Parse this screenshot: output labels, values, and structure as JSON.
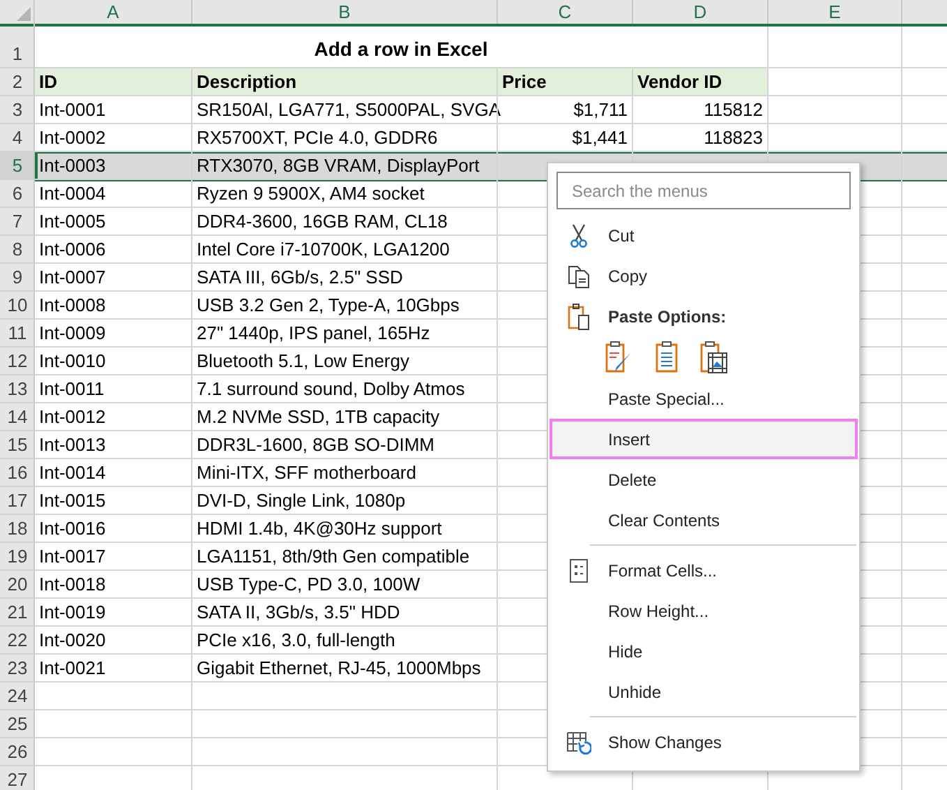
{
  "columns": [
    "A",
    "B",
    "C",
    "D",
    "E"
  ],
  "rows": [
    {
      "header": "1",
      "kind": "title",
      "selected": false,
      "title": "Add a row in Excel"
    },
    {
      "header": "2",
      "kind": "heading",
      "selected": false,
      "cells": [
        "ID",
        "Description",
        "Price",
        "Vendor ID"
      ]
    },
    {
      "header": "3",
      "kind": "data",
      "selected": false,
      "cells": [
        "Int-0001",
        "SR150Al, LGA771, S5000PAL, SVGA",
        "$1,711",
        "115812"
      ]
    },
    {
      "header": "4",
      "kind": "data",
      "selected": false,
      "cells": [
        "Int-0002",
        "RX5700XT, PCIe 4.0, GDDR6",
        "$1,441",
        "118823"
      ]
    },
    {
      "header": "5",
      "kind": "data",
      "selected": true,
      "cells": [
        "Int-0003",
        "RTX3070, 8GB VRAM, DisplayPort"
      ]
    },
    {
      "header": "6",
      "kind": "data",
      "selected": false,
      "cells": [
        "Int-0004",
        "Ryzen 9 5900X, AM4 socket"
      ]
    },
    {
      "header": "7",
      "kind": "data",
      "selected": false,
      "cells": [
        "Int-0005",
        "DDR4-3600, 16GB RAM, CL18"
      ]
    },
    {
      "header": "8",
      "kind": "data",
      "selected": false,
      "cells": [
        "Int-0006",
        "Intel Core i7-10700K, LGA1200"
      ]
    },
    {
      "header": "9",
      "kind": "data",
      "selected": false,
      "cells": [
        "Int-0007",
        "SATA III, 6Gb/s, 2.5\" SSD"
      ]
    },
    {
      "header": "10",
      "kind": "data",
      "selected": false,
      "cells": [
        "Int-0008",
        "USB 3.2 Gen 2, Type-A, 10Gbps"
      ]
    },
    {
      "header": "11",
      "kind": "data",
      "selected": false,
      "cells": [
        "Int-0009",
        "27\" 1440p, IPS panel, 165Hz"
      ]
    },
    {
      "header": "12",
      "kind": "data",
      "selected": false,
      "cells": [
        "Int-0010",
        "Bluetooth 5.1, Low Energy"
      ]
    },
    {
      "header": "13",
      "kind": "data",
      "selected": false,
      "cells": [
        "Int-0011",
        "7.1 surround sound, Dolby Atmos"
      ]
    },
    {
      "header": "14",
      "kind": "data",
      "selected": false,
      "cells": [
        "Int-0012",
        "M.2 NVMe SSD, 1TB capacity"
      ]
    },
    {
      "header": "15",
      "kind": "data",
      "selected": false,
      "cells": [
        "Int-0013",
        "DDR3L-1600, 8GB SO-DIMM"
      ]
    },
    {
      "header": "16",
      "kind": "data",
      "selected": false,
      "cells": [
        "Int-0014",
        "Mini-ITX, SFF motherboard"
      ]
    },
    {
      "header": "17",
      "kind": "data",
      "selected": false,
      "cells": [
        "Int-0015",
        "DVI-D, Single Link, 1080p"
      ]
    },
    {
      "header": "18",
      "kind": "data",
      "selected": false,
      "cells": [
        "Int-0016",
        "HDMI 1.4b, 4K@30Hz support"
      ]
    },
    {
      "header": "19",
      "kind": "data",
      "selected": false,
      "cells": [
        "Int-0017",
        "LGA1151, 8th/9th Gen compatible"
      ]
    },
    {
      "header": "20",
      "kind": "data",
      "selected": false,
      "cells": [
        "Int-0018",
        "USB Type-C, PD 3.0, 100W"
      ]
    },
    {
      "header": "21",
      "kind": "data",
      "selected": false,
      "cells": [
        "Int-0019",
        "SATA II, 3Gb/s, 3.5\" HDD"
      ]
    },
    {
      "header": "22",
      "kind": "data",
      "selected": false,
      "cells": [
        "Int-0020",
        "PCIe x16, 3.0, full-length"
      ]
    },
    {
      "header": "23",
      "kind": "data",
      "selected": false,
      "cells": [
        "Int-0021",
        "Gigabit Ethernet, RJ-45, 1000Mbps"
      ]
    },
    {
      "header": "24",
      "kind": "empty",
      "selected": false
    },
    {
      "header": "25",
      "kind": "empty",
      "selected": false
    },
    {
      "header": "26",
      "kind": "empty",
      "selected": false
    },
    {
      "header": "27",
      "kind": "empty",
      "selected": false
    }
  ],
  "context_menu": {
    "search": {
      "placeholder": "Search the menus"
    },
    "items": [
      {
        "kind": "cut",
        "label": "Cut",
        "selected": false
      },
      {
        "kind": "copy",
        "label": "Copy",
        "selected": false
      },
      {
        "kind": "paste_header",
        "label": "Paste Options:"
      },
      {
        "kind": "paste_icons"
      },
      {
        "kind": "item",
        "label": "Paste Special...",
        "selected": false
      },
      {
        "kind": "item",
        "label": "Insert",
        "selected": true
      },
      {
        "kind": "item",
        "label": "Delete",
        "selected": false
      },
      {
        "kind": "item",
        "label": "Clear Contents",
        "selected": false
      },
      {
        "kind": "separator"
      },
      {
        "kind": "format",
        "label": "Format Cells...",
        "selected": false
      },
      {
        "kind": "item",
        "label": "Row Height...",
        "selected": false
      },
      {
        "kind": "item",
        "label": "Hide",
        "selected": false
      },
      {
        "kind": "item",
        "label": "Unhide",
        "selected": false
      },
      {
        "kind": "separator"
      },
      {
        "kind": "changes",
        "label": "Show Changes",
        "selected": false
      }
    ]
  }
}
